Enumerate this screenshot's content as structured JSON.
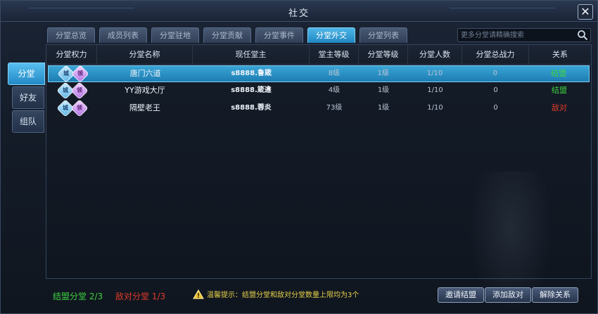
{
  "window": {
    "title": "社交",
    "close_label": "✕"
  },
  "tabs": [
    {
      "label": "分堂总览",
      "active": false
    },
    {
      "label": "成员列表",
      "active": false
    },
    {
      "label": "分堂驻地",
      "active": false
    },
    {
      "label": "分堂贡献",
      "active": false
    },
    {
      "label": "分堂事件",
      "active": false
    },
    {
      "label": "分堂外交",
      "active": true
    },
    {
      "label": "分堂列表",
      "active": false
    }
  ],
  "search": {
    "placeholder": "更多分堂请精确搜索"
  },
  "sidebar": [
    {
      "label": "分堂",
      "active": true
    },
    {
      "label": "好友",
      "active": false
    },
    {
      "label": "组队",
      "active": false
    }
  ],
  "table": {
    "headers": [
      "分堂权力",
      "分堂名称",
      "现任堂主",
      "堂主等级",
      "分堂等级",
      "分堂人数",
      "分堂总战力",
      "关系"
    ],
    "perm_badges": {
      "city": "城",
      "lead": "领"
    },
    "rows": [
      {
        "name": "唐门六道",
        "leader": "s8888.鲁箴",
        "leader_level": "8级",
        "branch_level": "1级",
        "members": "1/10",
        "power": "0",
        "relation": "结盟",
        "relation_type": "ally"
      },
      {
        "name": "YY游戏大厅",
        "leader": "s8888.箴違",
        "leader_level": "4级",
        "branch_level": "1级",
        "members": "1/10",
        "power": "0",
        "relation": "结盟",
        "relation_type": "ally"
      },
      {
        "name": "隔壁老王",
        "leader": "s8888.蓉炎",
        "leader_level": "73级",
        "branch_level": "1级",
        "members": "1/10",
        "power": "0",
        "relation": "敌对",
        "relation_type": "enemy"
      }
    ]
  },
  "footer": {
    "ally_count": "结盟分堂 2/3",
    "enemy_count": "敌对分堂 1/3",
    "tip": "温馨提示：结盟分堂和敌对分堂数量上限均为3个",
    "buttons": {
      "invite": "邀请结盟",
      "add_enemy": "添加敌对",
      "release": "解除关系"
    }
  },
  "colors": {
    "ally": "#3fd23f",
    "enemy": "#e23a2a",
    "accent": "#2a95d0",
    "tip": "#e8d24a"
  }
}
